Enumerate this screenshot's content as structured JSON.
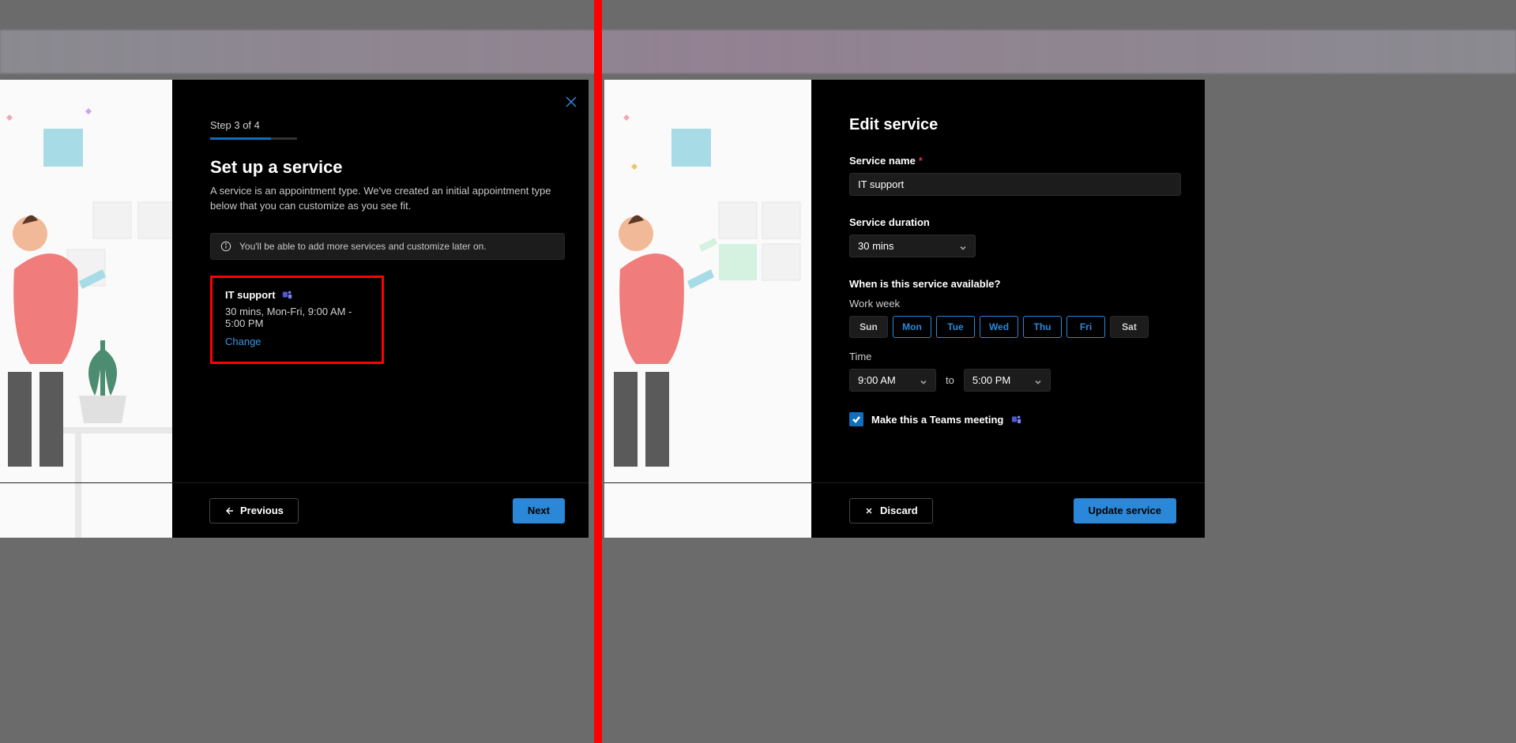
{
  "left": {
    "step": "Step 3 of 4",
    "progress_pct": 70,
    "title": "Set up a service",
    "subtitle": "A service is an appointment type. We've created an initial appointment type below that you can customize as you see fit.",
    "info": "You'll be able to add more services and customize later on.",
    "card": {
      "title": "IT support",
      "meta": "30 mins, Mon-Fri, 9:00 AM - 5:00 PM",
      "change": "Change"
    },
    "prev": "Previous",
    "next": "Next"
  },
  "right": {
    "title": "Edit service",
    "name_label": "Service name",
    "name_value": "IT support",
    "duration_label": "Service duration",
    "duration_value": "30 mins",
    "avail_label": "When is this service available?",
    "workweek_label": "Work week",
    "days": [
      {
        "abbr": "Sun",
        "on": false
      },
      {
        "abbr": "Mon",
        "on": true
      },
      {
        "abbr": "Tue",
        "on": true
      },
      {
        "abbr": "Wed",
        "on": true
      },
      {
        "abbr": "Thu",
        "on": true
      },
      {
        "abbr": "Fri",
        "on": true
      },
      {
        "abbr": "Sat",
        "on": false
      }
    ],
    "time_label": "Time",
    "time_from": "9:00 AM",
    "time_to_word": "to",
    "time_to": "5:00 PM",
    "teams_label": "Make this a Teams meeting",
    "discard": "Discard",
    "update": "Update service"
  }
}
